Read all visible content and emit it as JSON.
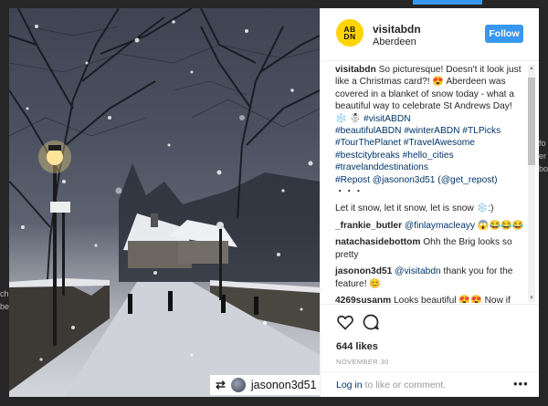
{
  "post": {
    "username": "visitabdn",
    "location": "Aberdeen",
    "avatar_text": "AB DN",
    "follow_label": "Follow",
    "caption_username": "visitabdn",
    "caption_lines": [
      "So picturesque! Doesn't it look",
      "just like a Christmas card?! 😍 Aberdeen",
      "was covered in a blanket of snow today -",
      "what a beautiful way to celebrate St",
      "Andrews Day! ❄️ ☃️"
    ],
    "caption_tags": [
      "#visitABDN",
      "#beautifulABDN #winterABDN #TLPicks",
      "#TourThePlanet #TravelAwesome",
      "#bestcitybreaks #hello_cities",
      "#travelanddestinations",
      "#Repost @jasonon3d51 (@get_repost)"
    ],
    "caption_tail": "・・・"
  },
  "comments": [
    {
      "user": "",
      "text": "Let it snow, let it snow, let is snow ❄️:)"
    },
    {
      "user": "_frankie_butler",
      "mention": "@finlaymacleayy",
      "text": " 😱😂😂😂"
    },
    {
      "user": "natachasidebottom",
      "mention": "",
      "text": "Ohh the Brig looks so pretty"
    },
    {
      "user": "jasonon3d51",
      "mention": "@visitabdn",
      "text": " thank you for the feature! 😊"
    },
    {
      "user": "4269susanm",
      "mention": "",
      "text": "Looks beautiful 😍😍 Now if only it would stay like that and not turn to"
    }
  ],
  "actions": {
    "like_icon": "heart-icon",
    "comment_icon": "comment-bubble-icon",
    "likes": "644 likes",
    "date": "NOVEMBER 30"
  },
  "login": {
    "link": "Log in",
    "rest": "to like or comment.",
    "more": "•••"
  },
  "photo": {
    "repost_user": "jasonon3d51",
    "repost_icon": "⇄"
  },
  "background": {
    "right_text": "fo\ner\nbo",
    "left_text": "ch\nbe"
  },
  "colors": {
    "follow_button": "#3897f0",
    "avatar_bg": "#ffd400",
    "link": "#003569"
  }
}
